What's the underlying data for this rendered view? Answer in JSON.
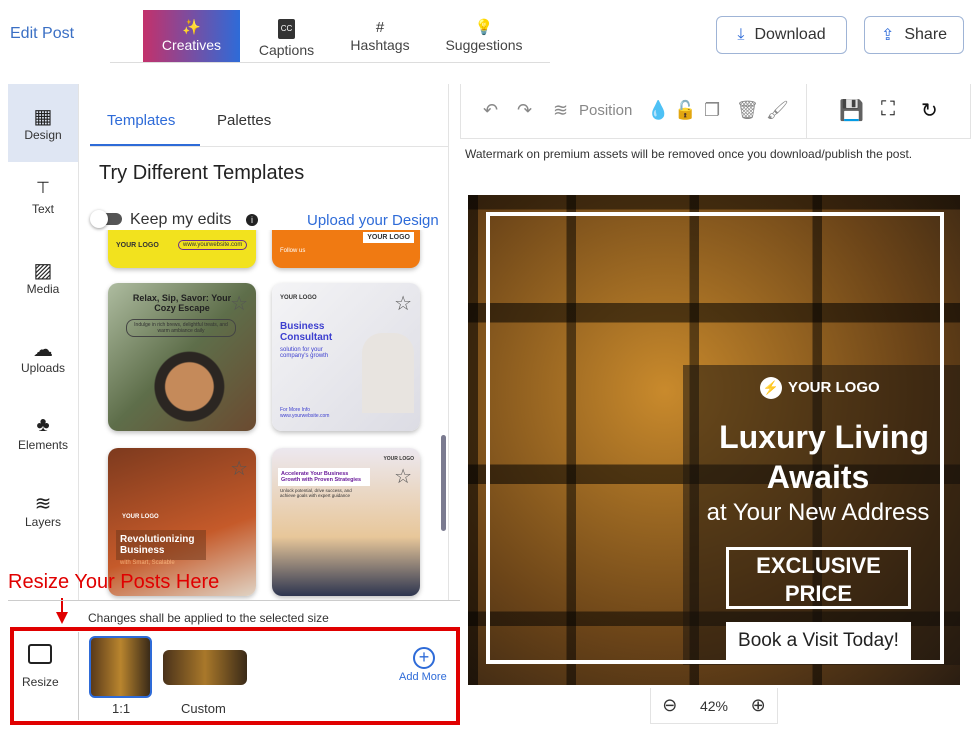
{
  "header": {
    "title": "Edit Post",
    "tabs": [
      {
        "label": "Creatives",
        "icon": "magic-wand-icon"
      },
      {
        "label": "Captions",
        "icon": "cc-icon"
      },
      {
        "label": "Hashtags",
        "icon": "hash-icon"
      },
      {
        "label": "Suggestions",
        "icon": "lightbulb-icon"
      }
    ],
    "download": "Download",
    "share": "Share"
  },
  "sidebar": {
    "items": [
      {
        "label": "Design"
      },
      {
        "label": "Text"
      },
      {
        "label": "Media"
      },
      {
        "label": "Uploads"
      },
      {
        "label": "Elements"
      },
      {
        "label": "Layers"
      }
    ],
    "resize": "Resize"
  },
  "panel": {
    "tabs": [
      "Templates",
      "Palettes"
    ],
    "title": "Try Different Templates",
    "keep_edits": "Keep my edits",
    "upload": "Upload your Design",
    "cards": [
      {
        "title": "Relax, Sip, Savor: Your Cozy Escape",
        "text": "Indulge in rich brews, delightful treats, and warm ambiance daily"
      },
      {
        "logo": "YOUR LOGO",
        "title": "Business Consultant",
        "sub": "solution for your company's growth",
        "foot": "For More Info www.yourwebsite.com"
      },
      {
        "logo": "YOUR LOGO",
        "title": "Revolutionizing Business",
        "sub": "with Smart, Scalable"
      },
      {
        "title": "Accelerate Your Business Growth with Proven Strategies",
        "text": "Unlock potential, drive success, and achieve goals with expert guidance",
        "logo": "YOUR LOGO"
      }
    ],
    "partial": [
      {
        "logo": "YOUR LOGO",
        "site": "www.yourwebsite.com"
      },
      {
        "follow": "Follow us",
        "logo": "YOUR LOGO"
      }
    ]
  },
  "annotation": "Resize Your Posts Here",
  "resize": {
    "note": "Changes shall be applied to the selected size",
    "sizes": [
      "1:1",
      "Custom"
    ],
    "add_more": "Add More"
  },
  "toolbar": {
    "position": "Position",
    "watermark": "Watermark on premium assets will be removed once you download/publish the post."
  },
  "canvas": {
    "logo": "YOUR LOGO",
    "headline1": "Luxury Living",
    "headline2": "Awaits",
    "sub": "at Your New Address",
    "badge1": "EXCLUSIVE",
    "badge2": "PRICE",
    "cta": "Book a Visit Today!"
  },
  "zoom": {
    "level": "42%"
  },
  "colors": {
    "accent": "#2e6bd8",
    "annotation": "#e00000"
  }
}
